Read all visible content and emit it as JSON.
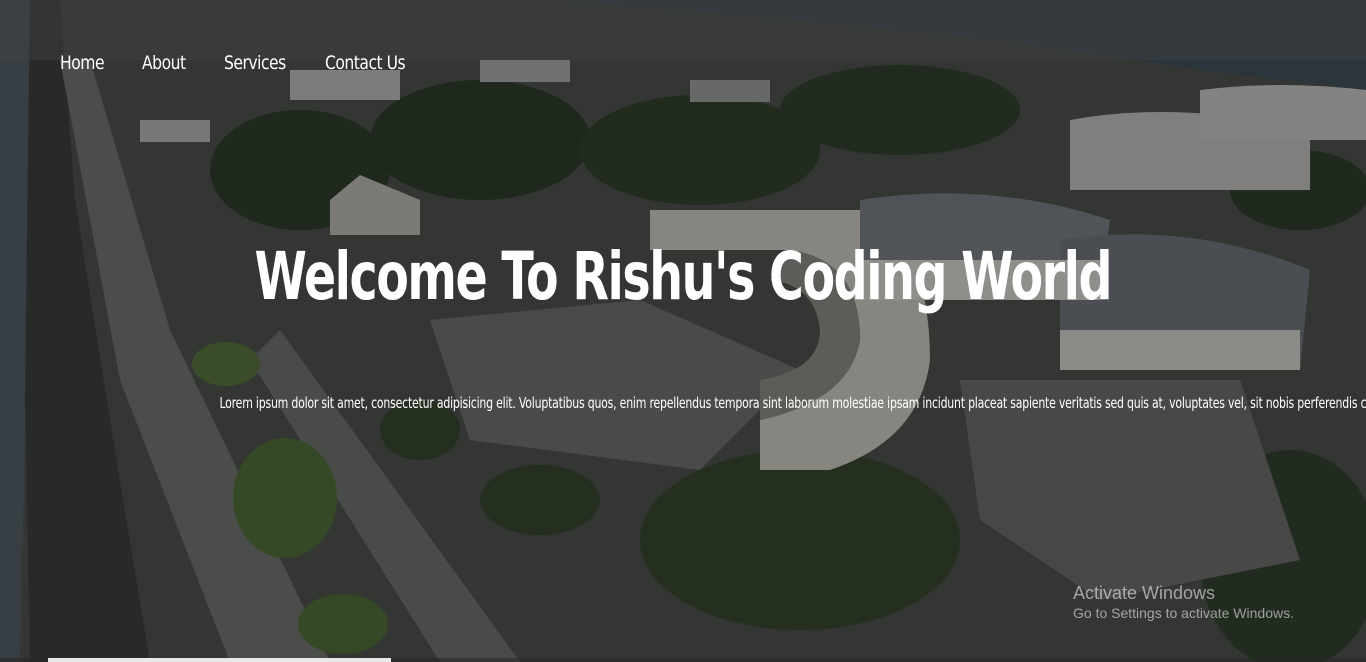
{
  "nav": {
    "items": [
      "Home",
      "About",
      "Services",
      "Contact Us"
    ]
  },
  "hero": {
    "title": "Welcome To Rishu's Coding World",
    "text": "Lorem ipsum dolor sit amet, consectetur adipisicing elit. Voluptatibus quos, enim repellendus tempora sint laborum molestiae ipsam incidunt placeat sapiente veritatis sed quis at, voluptates vel, sit nobis perferendis corporis."
  },
  "watermark": {
    "title": "Activate Windows",
    "subtitle": "Go to Settings to activate Windows."
  },
  "colors": {
    "text": "#ffffff",
    "overlay": "#0a0c0e"
  }
}
